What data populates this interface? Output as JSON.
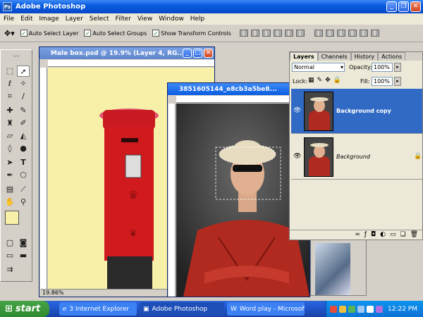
{
  "app": {
    "title": "Adobe Photoshop",
    "icon": "ps-icon"
  },
  "menu": [
    "File",
    "Edit",
    "Image",
    "Layer",
    "Select",
    "Filter",
    "View",
    "Window",
    "Help"
  ],
  "options": {
    "auto_select_layer": {
      "label": "Auto Select Layer",
      "checked": true
    },
    "auto_select_groups": {
      "label": "Auto Select Groups",
      "checked": true
    },
    "show_transform_controls": {
      "label": "Show Transform Controls",
      "checked": true
    }
  },
  "doc1": {
    "title": "Male box.psd @ 19.9% (Layer 4, RG...",
    "zoom": "19.86%"
  },
  "doc2": {
    "title": "3851605144_e8cb3a5be8..."
  },
  "layers_panel": {
    "tabs": [
      "Layers",
      "Channels",
      "History",
      "Actions"
    ],
    "blend_mode": "Normal",
    "opacity_label": "Opacity:",
    "opacity": "100%",
    "lock_label": "Lock:",
    "fill_label": "Fill:",
    "fill": "100%",
    "layers": [
      {
        "name": "Background copy",
        "active": true
      },
      {
        "name": "Background",
        "active": false
      }
    ]
  },
  "taskbar": {
    "start": "start",
    "tasks": [
      {
        "label": "3 Internet Explorer",
        "active": false
      },
      {
        "label": "Adobe Photoshop",
        "active": true
      },
      {
        "label": "Word play - Microsoft...",
        "active": false
      }
    ],
    "clock": "12:22 PM"
  },
  "colors": {
    "titlebar": "#0a5ce0",
    "canvas_bg": "#f7f0a8",
    "postbox_red": "#d01a1e",
    "shirt_red": "#b02a20",
    "layer_selected": "#316ac5",
    "taskbar": "#245edb",
    "start": "#3c9c3c"
  }
}
